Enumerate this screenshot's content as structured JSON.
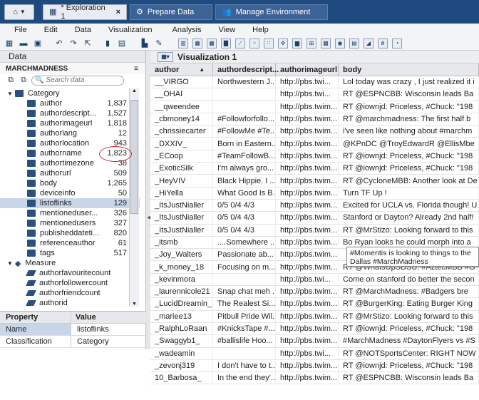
{
  "top_tabs": [
    {
      "label": "* Exploration 1",
      "active": true,
      "close": "×"
    },
    {
      "label": "Prepare Data",
      "active": false
    },
    {
      "label": "Manage Environment",
      "active": false
    }
  ],
  "menu": [
    "File",
    "Edit",
    "Data",
    "Visualization",
    "Analysis",
    "View",
    "Help"
  ],
  "data_panel": {
    "title": "Data",
    "source": "MARCHMADNESS",
    "search_placeholder": "Search data",
    "category_label": "Category",
    "measure_label": "Measure",
    "categories": [
      {
        "name": "author",
        "count": "1,837"
      },
      {
        "name": "authordescript...",
        "count": "1,527"
      },
      {
        "name": "authorimageurl",
        "count": "1,818"
      },
      {
        "name": "authorlang",
        "count": "12"
      },
      {
        "name": "authorlocation",
        "count": "943"
      },
      {
        "name": "authorname",
        "count": "1,823"
      },
      {
        "name": "authortimezone",
        "count": "38"
      },
      {
        "name": "authorurl",
        "count": "509"
      },
      {
        "name": "body",
        "count": "1,265"
      },
      {
        "name": "deviceinfo",
        "count": "50"
      },
      {
        "name": "listoflinks",
        "count": "129"
      },
      {
        "name": "mentioneduser...",
        "count": "326"
      },
      {
        "name": "mentionedusers",
        "count": "327"
      },
      {
        "name": "publisheddateti...",
        "count": "820"
      },
      {
        "name": "referenceauthor",
        "count": "61"
      },
      {
        "name": "tags",
        "count": "517"
      }
    ],
    "measures": [
      "authorfavouritecount",
      "authorfollowercount",
      "authorfriendcount",
      "authorid"
    ]
  },
  "properties": {
    "header": [
      "Property",
      "Value"
    ],
    "rows": [
      {
        "property": "Name",
        "value": "listoflinks"
      },
      {
        "property": "Classification",
        "value": "Category"
      }
    ]
  },
  "visualization": {
    "title": "Visualization 1",
    "columns": [
      "author",
      "authordescript...",
      "authorimageurl",
      "body"
    ],
    "rows": [
      [
        "__VIRGO",
        "Northwestern J...",
        "http://pbs.twi...",
        "Lol today was crazy , I just realized it i"
      ],
      [
        "__OHAI",
        "",
        "http://pbs.twi...",
        "RT @ESPNCBB: Wisconsin leads Ba"
      ],
      [
        "__qweendee",
        "",
        "http://pbs.twim...",
        "RT @iownjd: Priceless, #Chuck: \"198"
      ],
      [
        "_cbmoney14",
        "#Followforfollo...",
        "http://pbs.twim...",
        "RT @marchmadness: The first half b"
      ],
      [
        "_chrissiecarter",
        "#FollowMe #Te...",
        "http://pbs.twim...",
        "i've seen like nothing about #marchm"
      ],
      [
        "_DXXIV_",
        "Born in Eastern...",
        "http://pbs.twim...",
        "@KPnDC @TroyEdwardR @EllisMbe"
      ],
      [
        "_ECoop",
        "#TeamFollowB...",
        "http://pbs.twim...",
        "RT @iownjd: Priceless, #Chuck: \"198"
      ],
      [
        "_ExoticSilk",
        "I'm always gro...",
        "http://pbs.twim...",
        "RT @iownjd: Priceless, #Chuck: \"198"
      ],
      [
        "_HeyVIV",
        "Black Hippie. I ...",
        "http://pbs.twim...",
        "RT @CycloneMBB: Another look at De"
      ],
      [
        "_HiYella",
        "What Good Is B...",
        "http://pbs.twim...",
        "Turn TF Up !"
      ],
      [
        "_ItsJustNialler",
        "0/5  0/4  4/3",
        "http://pbs.twim...",
        "Excited for UCLA vs. Florida though! U"
      ],
      [
        "_ItsJustNialler",
        "0/5  0/4  4/3",
        "http://pbs.twim...",
        "Stanford or Dayton? Already 2nd half!"
      ],
      [
        "_ItsJustNialler",
        "0/5  0/4  4/3",
        "http://pbs.twim...",
        "RT @MrStizo: Looking forward to this"
      ],
      [
        "_itsmb",
        "....Somewhere ...",
        "http://pbs.twim...",
        "Bo Ryan looks he could morph into a"
      ],
      [
        "_Joy_Walters",
        "Passionate ab...",
        "http://pbs.twim...",
        ""
      ],
      [
        "_k_money_18",
        "Focusing on m...",
        "http://pbs.twim...",
        "RT @WhatsUpSDSU: #AztecMBB #G"
      ],
      [
        "_kevinmora",
        "",
        "http://pbs.twi...",
        "Come on stanford do better the secon"
      ],
      [
        "_laurennicole21",
        "Snap chat meh ...",
        "http://pbs.twim...",
        "RT @MarchMadness: #Badgers bre"
      ],
      [
        "_LucidDreamin_",
        "The Realest Si...",
        "http://pbs.twim...",
        "RT @BurgerKing: Eating Burger King"
      ],
      [
        "_mariee13",
        "Pitbull Pride Wil...",
        "http://pbs.twim...",
        "RT @MrStizo: Looking forward to this"
      ],
      [
        "_RalphLoRaan",
        "#KnicksTape #...",
        "http://pbs.twim...",
        "RT @iownjd: Priceless, #Chuck: \"198"
      ],
      [
        "_Swaggyb1_",
        "#ballislife Hoo...",
        "http://pbs.twim...",
        "#MarchMadness #DaytonFlyers vs #S"
      ],
      [
        "_wadeamin",
        "",
        "http://pbs.twi...",
        "RT @NOTSportsCenter: RIGHT NOW"
      ],
      [
        "_zevonj319",
        "I don't have to t...",
        "http://pbs.twim...",
        "RT @iownjd: Priceless, #Chuck: \"198"
      ],
      [
        "10_Barbosa_",
        "In the end they'...",
        "http://pbs.twim...",
        "RT @ESPNCBB: Wisconsin leads Ba"
      ]
    ],
    "tooltip_line1": "#Momentis is looking to things to the",
    "tooltip_line2": "Dallas #MarchMadness"
  }
}
